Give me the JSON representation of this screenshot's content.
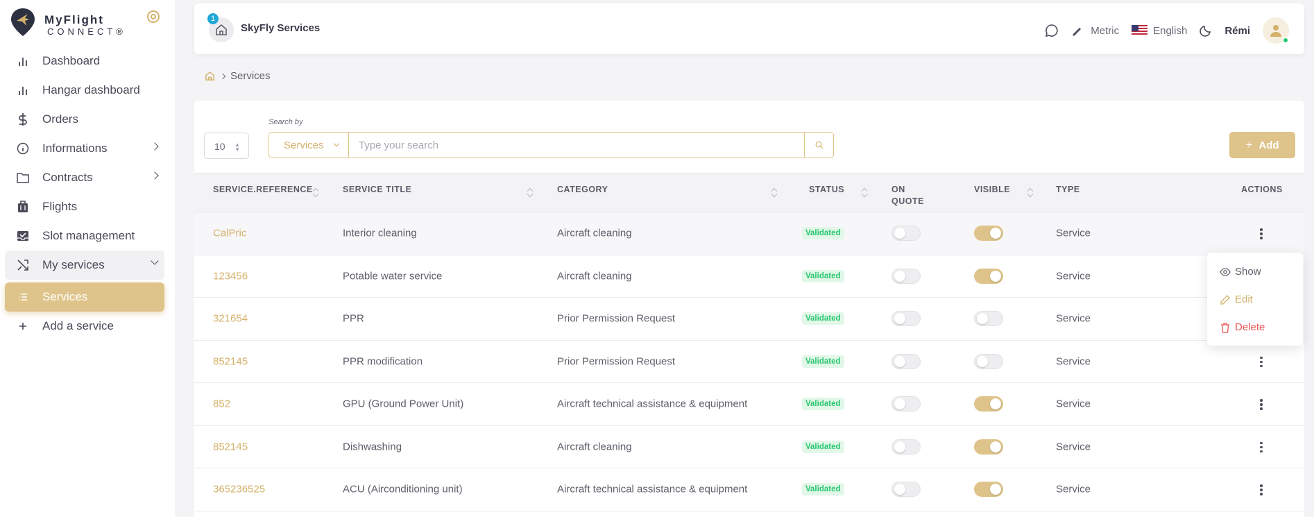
{
  "logo": {
    "line1": "MyFlight",
    "line2": "CONNECT®"
  },
  "sidebar": {
    "items": [
      {
        "label": "Dashboard",
        "icon": "bar-chart-icon"
      },
      {
        "label": "Hangar dashboard",
        "icon": "bar-chart-icon"
      },
      {
        "label": "Orders",
        "icon": "dollar-icon"
      },
      {
        "label": "Informations",
        "icon": "info-icon"
      },
      {
        "label": "Contracts",
        "icon": "folder-icon"
      },
      {
        "label": "Flights",
        "icon": "luggage-icon"
      },
      {
        "label": "Slot management",
        "icon": "inbox-check-icon"
      },
      {
        "label": "My services",
        "icon": "shuffle-icon"
      },
      {
        "label": "Services",
        "icon": "list-icon"
      },
      {
        "label": "Add a service",
        "icon": "plus-icon"
      }
    ]
  },
  "topbar": {
    "badge": "1",
    "org_name": "SkyFly Services",
    "units": "Metric",
    "language": "English",
    "user": "Rémi"
  },
  "breadcrumb": {
    "current": "Services"
  },
  "toolbar": {
    "page_size": "10",
    "search_label": "Search by",
    "search_field": "Services",
    "search_placeholder": "Type your search",
    "add_label": "Add"
  },
  "table": {
    "headers": [
      "SERVICE.REFERENCE",
      "SERVICE TITLE",
      "CATEGORY",
      "STATUS",
      "ON QUOTE",
      "VISIBLE",
      "TYPE",
      "ACTIONS"
    ],
    "rows": [
      {
        "ref": "CalPric",
        "title": "Interior cleaning",
        "category": "Aircraft cleaning",
        "status": "Validated",
        "on_quote": false,
        "visible": true,
        "type": "Service"
      },
      {
        "ref": "123456",
        "title": "Potable water service",
        "category": "Aircraft cleaning",
        "status": "Validated",
        "on_quote": false,
        "visible": true,
        "type": "Service"
      },
      {
        "ref": "321654",
        "title": "PPR",
        "category": "Prior Permission Request",
        "status": "Validated",
        "on_quote": false,
        "visible": false,
        "type": "Service"
      },
      {
        "ref": "852145",
        "title": "PPR modification",
        "category": "Prior Permission Request",
        "status": "Validated",
        "on_quote": false,
        "visible": false,
        "type": "Service"
      },
      {
        "ref": "852",
        "title": "GPU (Ground Power Unit)",
        "category": "Aircraft technical assistance & equipment",
        "status": "Validated",
        "on_quote": false,
        "visible": true,
        "type": "Service"
      },
      {
        "ref": "852145",
        "title": "Dishwashing",
        "category": "Aircraft cleaning",
        "status": "Validated",
        "on_quote": false,
        "visible": true,
        "type": "Service"
      },
      {
        "ref": "365236525",
        "title": "ACU (Airconditioning unit)",
        "category": "Aircraft technical assistance & equipment",
        "status": "Validated",
        "on_quote": false,
        "visible": true,
        "type": "Service"
      }
    ]
  },
  "action_menu": {
    "show": "Show",
    "edit": "Edit",
    "delete": "Delete"
  },
  "colors": {
    "accent": "#dec48a",
    "accent_text": "#d4b16a",
    "success": "#28c76f",
    "danger": "#ea5455"
  }
}
